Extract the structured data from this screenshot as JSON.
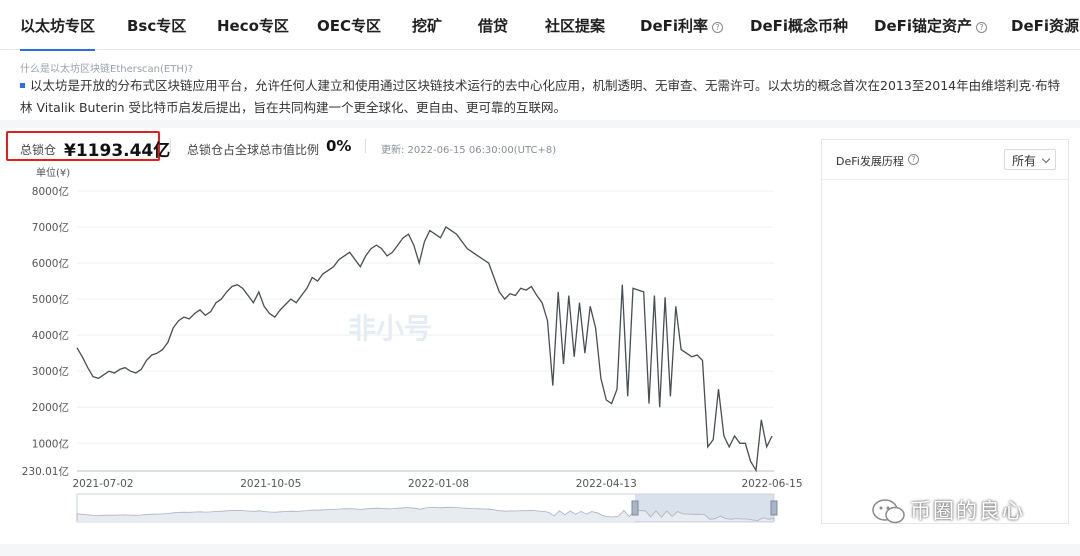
{
  "tabs": [
    {
      "label": "以太坊专区",
      "active": true
    },
    {
      "label": "Bsc专区"
    },
    {
      "label": "Heco专区"
    },
    {
      "label": "OEC专区"
    },
    {
      "label": "挖矿"
    },
    {
      "label": "借贷"
    },
    {
      "label": "社区提案"
    },
    {
      "label": "DeFi利率",
      "help": true
    },
    {
      "label": "DeFi概念币种"
    },
    {
      "label": "DeFi锚定资产",
      "help": true
    },
    {
      "label": "DeFi资源"
    }
  ],
  "intro": {
    "link": "什么是以太坊区块链Etherscan(ETH)?",
    "text": "以太坊是开放的分布式区块链应用平台，允许任何人建立和使用通过区块链技术运行的去中心化应用，机制透明、无审查、无需许可。以太坊的概念首次在2013至2014年由维塔利克·布特林 Vitalik Buterin 受比特币启发后提出，旨在共同构建一个更全球化、更自由、更可靠的互联网。"
  },
  "stats": {
    "tvl_label": "总锁仓",
    "tvl_value": "¥1193.44亿",
    "ratio_label": "总锁仓占全球总市值比例",
    "ratio_value": "0%",
    "update": "更新: 2022-06-15 06:30:00(UTC+8)"
  },
  "chart_data": {
    "type": "line",
    "unit_label": "单位(¥)",
    "y_tick_labels": [
      "230.01亿",
      "1000亿",
      "2000亿",
      "3000亿",
      "4000亿",
      "5000亿",
      "6000亿",
      "7000亿",
      "8000亿"
    ],
    "y_tick_values": [
      230.01,
      1000,
      2000,
      3000,
      4000,
      5000,
      6000,
      7000,
      8000
    ],
    "ylim": [
      230.01,
      8000
    ],
    "x_tick_labels": [
      "2021-07-02",
      "2021-10-05",
      "2022-01-08",
      "2022-04-13",
      "2022-06-15"
    ],
    "watermark": "非小号",
    "line_color": "#4a4d52",
    "series": [
      {
        "values": [
          3650,
          3400,
          3100,
          2850,
          2800,
          2900,
          3000,
          2950,
          3050,
          3100,
          3000,
          2950,
          3050,
          3300,
          3450,
          3500,
          3600,
          3800,
          4200,
          4400,
          4500,
          4450,
          4600,
          4700,
          4550,
          4650,
          4900,
          5000,
          5200,
          5350,
          5400,
          5300,
          5100,
          4900,
          5200,
          4800,
          4600,
          4500,
          4700,
          4850,
          5000,
          4900,
          5100,
          5300,
          5600,
          5500,
          5700,
          5800,
          5900,
          6100,
          6200,
          6300,
          6100,
          5900,
          6200,
          6400,
          6500,
          6400,
          6200,
          6300,
          6500,
          6700,
          6800,
          6500,
          6000,
          6600,
          6900,
          6800,
          6700,
          7000,
          6900,
          6800,
          6600,
          6400,
          6300,
          6200,
          6100,
          6000,
          5600,
          5200,
          5000,
          5150,
          5100,
          5300,
          5250,
          5350,
          5100,
          4900,
          4400,
          2600,
          5200,
          3200,
          5100,
          3400,
          4900,
          3500,
          4800,
          4200,
          2800,
          2200,
          2100,
          2500,
          5400,
          2300,
          5300,
          5250,
          5200,
          2100,
          5100,
          2000,
          5050,
          2300,
          4800,
          3600,
          3500,
          3400,
          3450,
          3300,
          900,
          1100,
          2500,
          1200,
          900,
          1200,
          1000,
          1000,
          500,
          250,
          1650,
          900,
          1200
        ]
      }
    ]
  },
  "side": {
    "title": "DeFi发展历程",
    "filter": "所有"
  },
  "wechat_text": "币圈的良心"
}
